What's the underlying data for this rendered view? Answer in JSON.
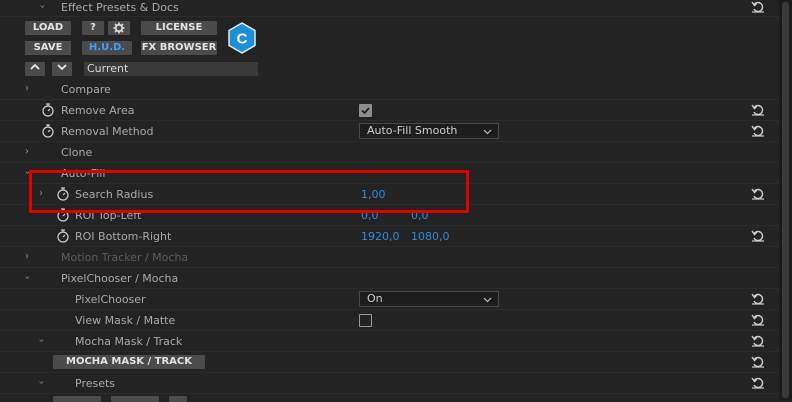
{
  "header": {
    "title": "Effect Presets & Docs",
    "buttons": {
      "load": "LOAD",
      "help": "?",
      "settings_icon": "gear-icon",
      "license": "LICENSE",
      "save": "SAVE",
      "hud": "H.U.D.",
      "fx_browser": "FX BROWSER"
    },
    "logo_letter": "C",
    "preset_current": "Current"
  },
  "rows": {
    "compare": {
      "label": "Compare"
    },
    "remove_area": {
      "label": "Remove Area",
      "checked": true
    },
    "removal_method": {
      "label": "Removal Method",
      "value": "Auto-Fill Smooth"
    },
    "clone": {
      "label": "Clone"
    },
    "auto_fill": {
      "label": "Auto-Fill"
    },
    "search_radius": {
      "label": "Search Radius",
      "value": "1,00"
    },
    "roi_top_left": {
      "label": "ROI Top-Left",
      "x": "0,0",
      "y": "0,0"
    },
    "roi_bottom_right": {
      "label": "ROI Bottom-Right",
      "x": "1920,0",
      "y": "1080,0"
    },
    "motion_tracker": {
      "label": "Motion Tracker / Mocha"
    },
    "pixelchooser_group": {
      "label": "PixelChooser / Mocha"
    },
    "pixelchooser": {
      "label": "PixelChooser",
      "value": "On"
    },
    "view_mask": {
      "label": "View Mask / Matte",
      "checked": false
    },
    "mocha_mask_track": {
      "label": "Mocha Mask / Track"
    },
    "mocha_button": {
      "label": "MOCHA MASK / TRACK"
    },
    "presets": {
      "label": "Presets"
    }
  },
  "colors": {
    "background": "#232323",
    "value_blue": "#2f8bd8",
    "hud_blue": "#3aa0ff",
    "highlight_red": "#e00000",
    "logo_blue": "#1a8fd8"
  }
}
